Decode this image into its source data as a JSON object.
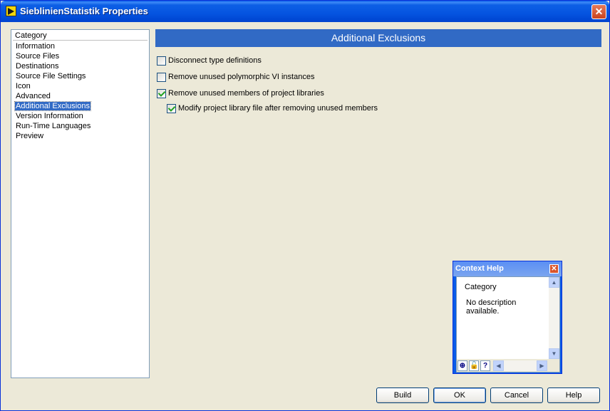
{
  "window": {
    "title": "SieblinienStatistik Properties",
    "close_label": "✕"
  },
  "sidebar": {
    "header": "Category",
    "items": [
      {
        "label": "Information",
        "selected": false
      },
      {
        "label": "Source Files",
        "selected": false
      },
      {
        "label": "Destinations",
        "selected": false
      },
      {
        "label": "Source File Settings",
        "selected": false
      },
      {
        "label": "Icon",
        "selected": false
      },
      {
        "label": "Advanced",
        "selected": false
      },
      {
        "label": "Additional Exclusions",
        "selected": true
      },
      {
        "label": "Version Information",
        "selected": false
      },
      {
        "label": "Run-Time Languages",
        "selected": false
      },
      {
        "label": "Preview",
        "selected": false
      }
    ]
  },
  "main": {
    "title": "Additional Exclusions",
    "options": [
      {
        "label": "Disconnect type definitions",
        "checked": false
      },
      {
        "label": "Remove unused polymorphic VI instances",
        "checked": false
      },
      {
        "label": "Remove unused members of project libraries",
        "checked": true
      },
      {
        "label": "Modify project library file after removing unused members",
        "checked": true
      }
    ]
  },
  "context_help": {
    "title": "Context Help",
    "close_label": "✕",
    "topic": "Category",
    "description": "No description available."
  },
  "buttons": {
    "build": "Build",
    "ok": "OK",
    "cancel": "Cancel",
    "help": "Help"
  },
  "colors": {
    "accent": "#316ac5",
    "titlebar": "#0054e3",
    "check": "#21a121"
  }
}
